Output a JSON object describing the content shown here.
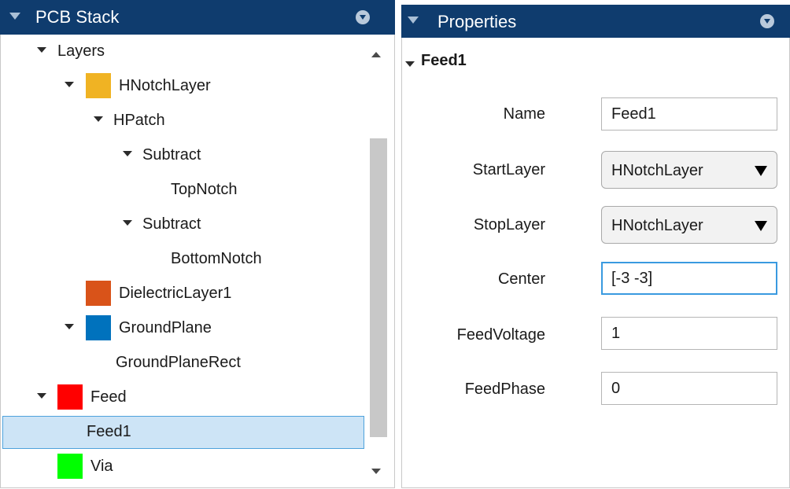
{
  "pcb_stack": {
    "title": "PCB Stack",
    "tree": [
      {
        "label": "Layers",
        "expanded": true,
        "level": 0
      },
      {
        "label": "HNotchLayer",
        "expanded": true,
        "level": 1,
        "swatch_color": "#f0b323"
      },
      {
        "label": "HPatch",
        "expanded": true,
        "level": 2
      },
      {
        "label": "Subtract",
        "expanded": true,
        "level": 3
      },
      {
        "label": "TopNotch",
        "level": 4
      },
      {
        "label": "Subtract",
        "expanded": true,
        "level": 3
      },
      {
        "label": "BottomNotch",
        "level": 4
      },
      {
        "label": "DielectricLayer1",
        "level": 1,
        "swatch_color": "#d95319"
      },
      {
        "label": "GroundPlane",
        "expanded": true,
        "level": 1,
        "swatch_color": "#0072bd"
      },
      {
        "label": "GroundPlaneRect",
        "level": 2
      },
      {
        "label": "Feed",
        "expanded": true,
        "level": 0,
        "swatch_color": "#ff0000"
      },
      {
        "label": "Feed1",
        "level": 1,
        "selected": true
      },
      {
        "label": "Via",
        "level": 0,
        "swatch_color": "#00ff00"
      }
    ]
  },
  "properties": {
    "title": "Properties",
    "section_title": "Feed1",
    "fields": [
      {
        "label": "Name",
        "value": "Feed1",
        "kind": "text"
      },
      {
        "label": "StartLayer",
        "value": "HNotchLayer",
        "kind": "dropdown"
      },
      {
        "label": "StopLayer",
        "value": "HNotchLayer",
        "kind": "dropdown"
      },
      {
        "label": "Center",
        "value": "[-3 -3]",
        "kind": "text",
        "focused": true
      },
      {
        "label": "FeedVoltage",
        "value": "1",
        "kind": "text"
      },
      {
        "label": "FeedPhase",
        "value": "0",
        "kind": "text"
      }
    ]
  },
  "colors": {
    "header_bg": "#0f3c6e",
    "selection_bg": "#cde4f6",
    "selection_border": "#4ea2dc",
    "focus_border": "#3a9ae0"
  },
  "icons": {
    "expand": "triangle-down-icon",
    "panel_menu": "panel-menu-icon",
    "scroll_up": "scroll-up-arrow-icon",
    "scroll_down": "scroll-down-arrow-icon",
    "dropdown": "dropdown-arrow-icon"
  }
}
